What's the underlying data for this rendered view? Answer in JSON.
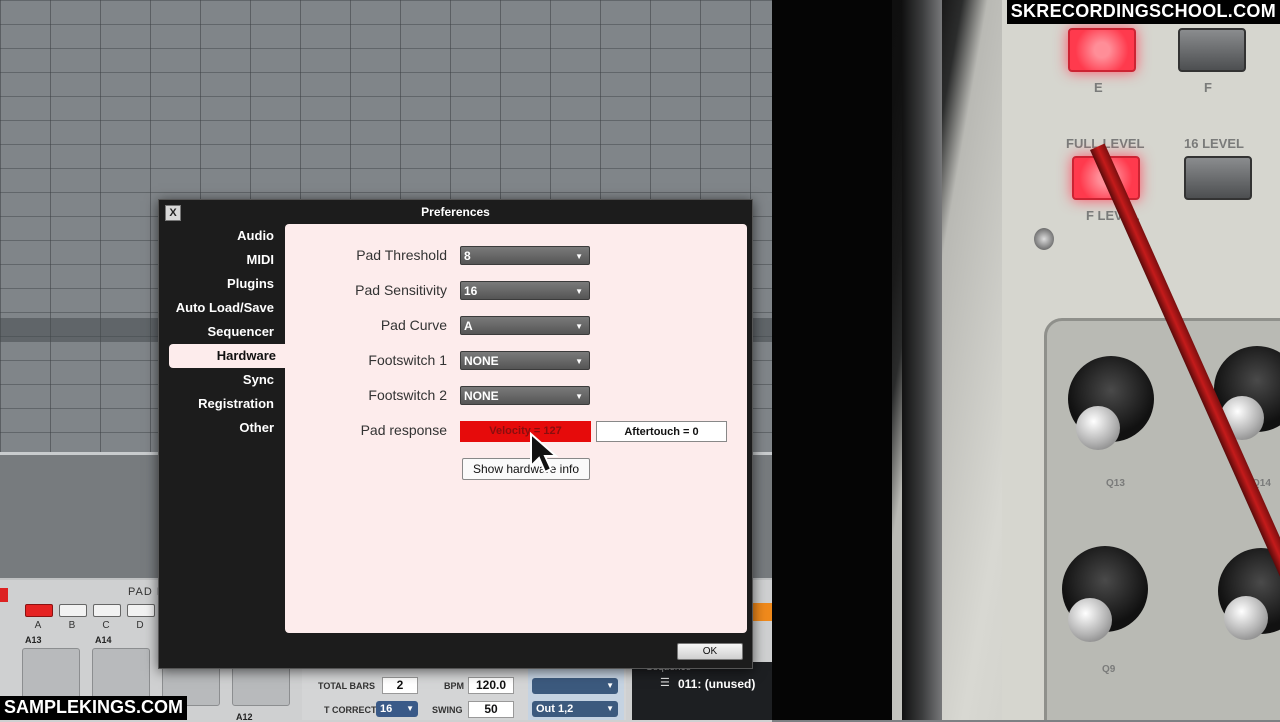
{
  "dialog": {
    "title": "Preferences",
    "close_label": "X",
    "nav": [
      "Audio",
      "MIDI",
      "Plugins",
      "Auto Load/Save",
      "Sequencer",
      "Hardware",
      "Sync",
      "Registration",
      "Other"
    ],
    "selected_nav": "Hardware",
    "fields": [
      {
        "label": "Pad Threshold",
        "value": "8"
      },
      {
        "label": "Pad Sensitivity",
        "value": "16"
      },
      {
        "label": "Pad Curve",
        "value": "A"
      },
      {
        "label": "Footswitch 1",
        "value": "NONE"
      },
      {
        "label": "Footswitch 2",
        "value": "NONE"
      }
    ],
    "pad_response": {
      "label": "Pad response",
      "velocity": "Velocity = 127",
      "aftertouch": "Aftertouch = 0"
    },
    "show_hw_info_label": "Show hardware info",
    "ok_label": "OK"
  },
  "pad_panel": {
    "title": "PAD B",
    "banks": [
      "A",
      "B",
      "C",
      "D"
    ],
    "active_bank": "A",
    "pad_labels": [
      "A13",
      "A14",
      "A11",
      "A12"
    ]
  },
  "transport": {
    "total_bars_label": "TOTAL BARS",
    "total_bars": "2",
    "bpm_label": "BPM",
    "bpm": "120.0",
    "t_correct_label": "T CORRECT",
    "t_correct": "16",
    "swing_label": "SWING",
    "swing": "50",
    "output": "Out 1,2"
  },
  "sequence": {
    "label": "Sequence",
    "value": "011: (unused)"
  },
  "hardware_photo": {
    "buttons": [
      "E",
      "F",
      "FULL LEVEL",
      "16 LEVEL"
    ],
    "partial_label": "F LEVEL",
    "knob_labels": [
      "Q13",
      "Q14",
      "Q9"
    ]
  },
  "watermarks": {
    "top": "SKRECORDINGSCHOOL.COM",
    "bottom": "SAMPLEKINGS.COM"
  },
  "colors": {
    "accent_red": "#e60b0b",
    "dialog_bg": "#1c1c1c",
    "content_bg": "#fdecec"
  }
}
